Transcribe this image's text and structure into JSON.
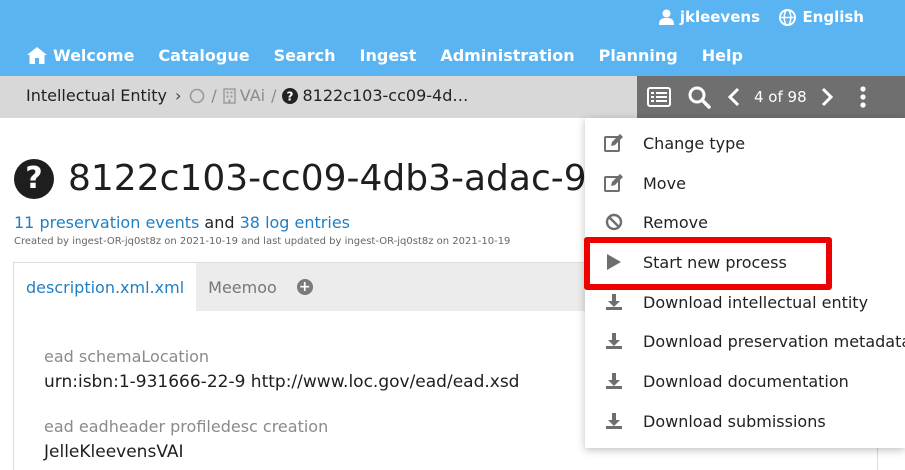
{
  "topbar": {
    "user": "jkleevens",
    "language": "English",
    "nav": [
      {
        "label": "Welcome",
        "icon": "home-icon"
      },
      {
        "label": "Catalogue"
      },
      {
        "label": "Search"
      },
      {
        "label": "Ingest"
      },
      {
        "label": "Administration"
      },
      {
        "label": "Planning"
      },
      {
        "label": "Help"
      }
    ]
  },
  "breadcrumb": {
    "section": "Intellectual Entity",
    "level1": "VAi",
    "current": "8122c103-cc09-4d…"
  },
  "toolbar": {
    "pager": "4 of 98"
  },
  "entity": {
    "title": "8122c103-cc09-4db3-adac-9",
    "events_link": "11 preservation events",
    "events_and": " and ",
    "logs_link": "38 log entries",
    "created": "Created by ingest-OR-jq0st8z on 2021-10-19 and last updated by ingest-OR-jq0st8z on 2021-10-19"
  },
  "tabs": [
    {
      "label": "description.xml.xml"
    },
    {
      "label": "Meemoo"
    }
  ],
  "fields": [
    {
      "label": "ead schemaLocation",
      "value": "urn:isbn:1-931666-22-9 http://www.loc.gov/ead/ead.xsd"
    },
    {
      "label": "ead eadheader profiledesc creation",
      "value": "JelleKleevensVAI"
    }
  ],
  "menu": [
    {
      "label": "Change type",
      "icon": "edit-icon"
    },
    {
      "label": "Move",
      "icon": "edit-icon"
    },
    {
      "label": "Remove",
      "icon": "ban-icon"
    },
    {
      "label": "Start new process",
      "icon": "play-icon"
    },
    {
      "label": "Download intellectual entity",
      "icon": "download-icon"
    },
    {
      "label": "Download preservation metadata",
      "icon": "download-icon"
    },
    {
      "label": "Download documentation",
      "icon": "download-icon"
    },
    {
      "label": "Download submissions",
      "icon": "download-icon"
    }
  ],
  "colors": {
    "topbar": "#5ab4f2",
    "link": "#1f7fc4",
    "toolbar": "#6f6f6f",
    "highlight": "#ee0000"
  }
}
